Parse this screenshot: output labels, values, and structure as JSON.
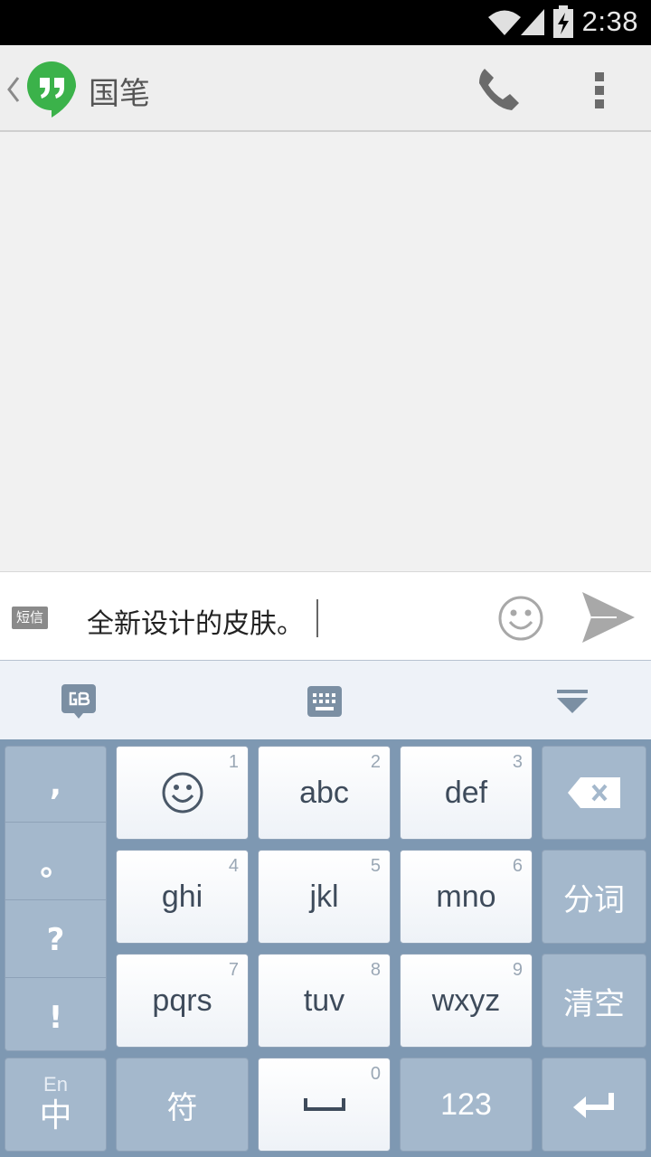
{
  "status_bar": {
    "time": "2:38",
    "icons": [
      "wifi-icon",
      "signal-icon",
      "battery-charging-icon"
    ]
  },
  "app_bar": {
    "contact_name": "国笔",
    "icons": [
      "back-chevron-icon",
      "hangouts-logo-icon",
      "phone-icon",
      "overflow-menu-icon"
    ]
  },
  "compose": {
    "sms_badge": "短信",
    "text": "全新设计的皮肤。",
    "icons": [
      "emoji-icon",
      "send-icon"
    ]
  },
  "keyboard_toolbar": {
    "icons": [
      "gb-logo-icon",
      "keyboard-icon",
      "hide-keyboard-icon"
    ]
  },
  "keyboard": {
    "punctuation": [
      ",",
      "。",
      "?",
      "!"
    ],
    "rows": [
      [
        {
          "label": "",
          "num": "1",
          "icon": "emoji-icon"
        },
        {
          "label": "abc",
          "num": "2"
        },
        {
          "label": "def",
          "num": "3"
        }
      ],
      [
        {
          "label": "ghi",
          "num": "4"
        },
        {
          "label": "jkl",
          "num": "5"
        },
        {
          "label": "mno",
          "num": "6"
        }
      ],
      [
        {
          "label": "pqrs",
          "num": "7"
        },
        {
          "label": "tuv",
          "num": "8"
        },
        {
          "label": "wxyz",
          "num": "9"
        }
      ]
    ],
    "right_keys": {
      "delete_icon": "backspace-icon",
      "segment": "分词",
      "clear": "清空",
      "enter_icon": "enter-icon"
    },
    "bottom": {
      "lang_top": "En",
      "lang_main": "中",
      "symbols": "符",
      "space_num": "0",
      "space_icon": "space-bar-icon",
      "numbers": "123"
    }
  }
}
